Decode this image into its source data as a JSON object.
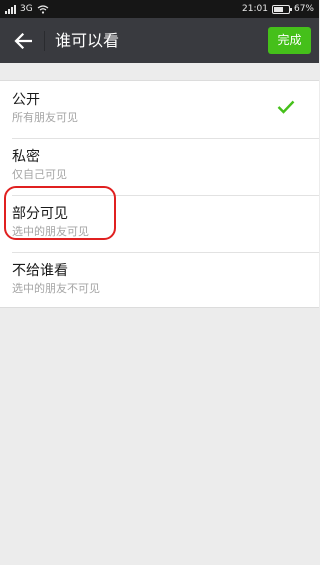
{
  "status_bar": {
    "network": "3G",
    "time": "21:01",
    "battery_percent": "67%",
    "battery_level": 0.67
  },
  "header": {
    "title": "谁可以看",
    "done_label": "完成",
    "done_color": "#45c01a",
    "background_color": "#393a3f"
  },
  "options": [
    {
      "title": "公开",
      "description": "所有朋友可见",
      "selected": true
    },
    {
      "title": "私密",
      "description": "仅自己可见",
      "selected": false
    },
    {
      "title": "部分可见",
      "description": "选中的朋友可见",
      "selected": false
    },
    {
      "title": "不给谁看",
      "description": "选中的朋友不可见",
      "selected": false
    }
  ],
  "accent_color": "#45c01a",
  "annotation_color": "#e02020"
}
